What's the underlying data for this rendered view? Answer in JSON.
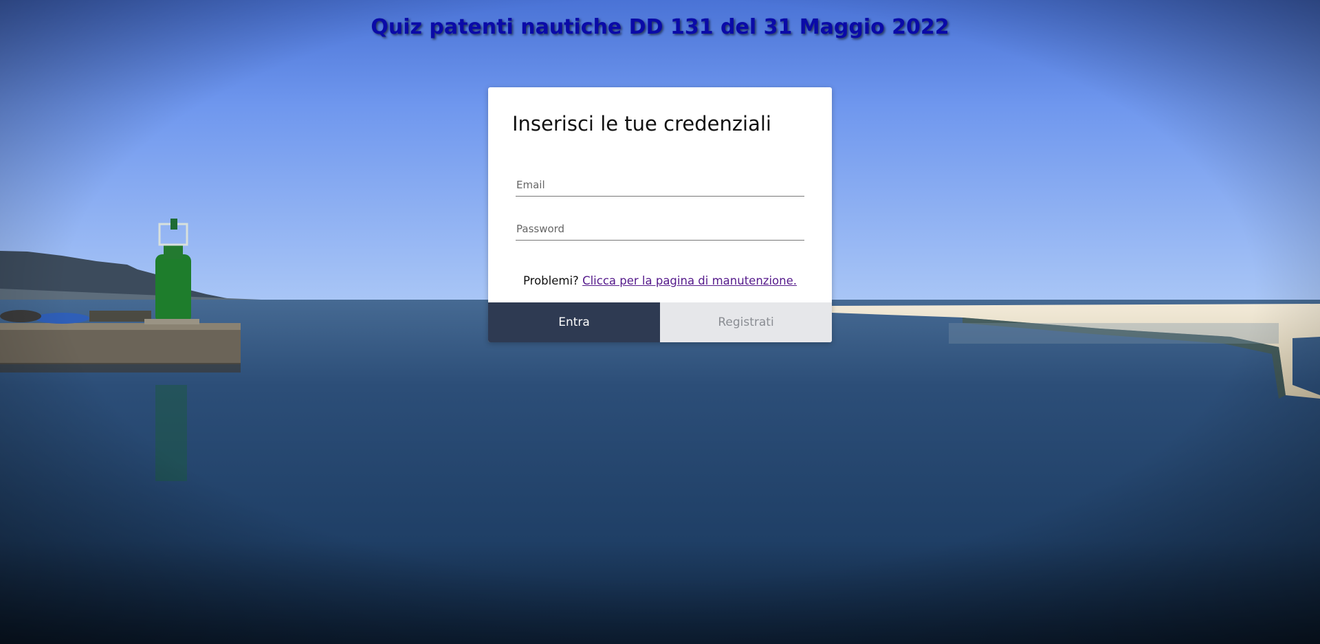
{
  "page": {
    "title": "Quiz patenti nautiche DD 131 del 31 Maggio 2022"
  },
  "login_card": {
    "heading": "Inserisci le tue credenziali",
    "email_placeholder": "Email",
    "password_placeholder": "Password",
    "help_prefix": "Problemi?",
    "help_link": "Clicca per la pagina di manutenzione.",
    "login_button": "Entra",
    "register_button": "Registrati"
  },
  "colors": {
    "title": "#0a0aa8",
    "primary_button": "#2e3a52",
    "secondary_button": "#e6e7ea",
    "link": "#551a8b"
  }
}
